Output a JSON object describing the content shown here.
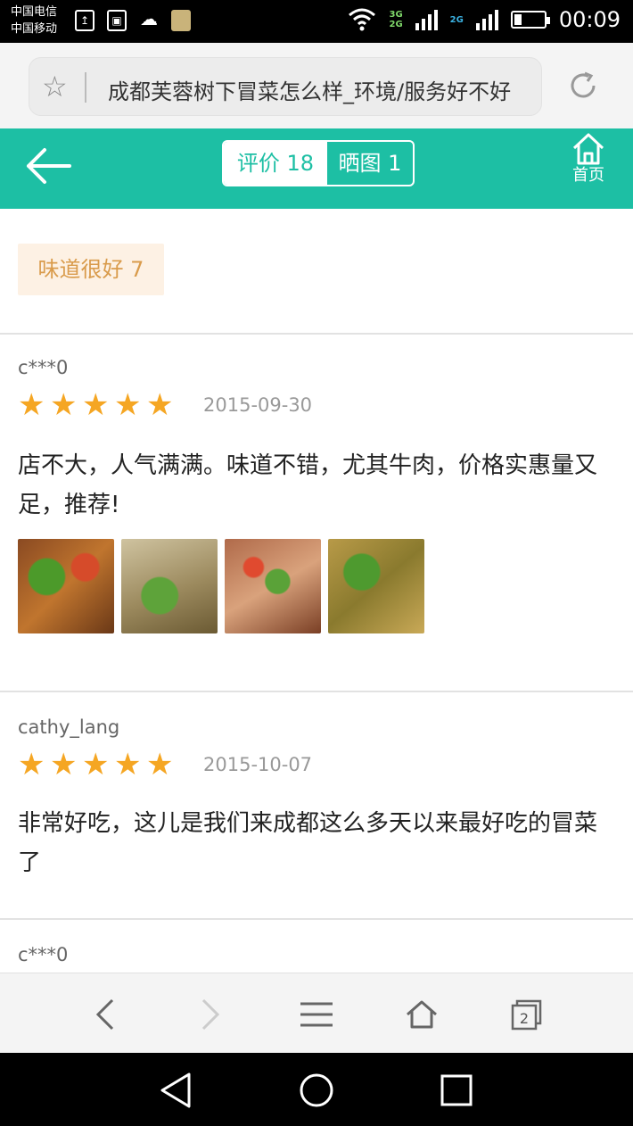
{
  "status_bar": {
    "carrier_1": "中国电信",
    "carrier_2": "中国移动",
    "net_1": "3G",
    "net_2": "2G",
    "net_3": "2G",
    "time": "00:09"
  },
  "browser": {
    "url_title": "成都芙蓉树下冒菜怎么样_环境/服务好不好",
    "tabs_count": "2"
  },
  "header": {
    "tab_reviews": "评价 18",
    "tab_photos": "晒图 1",
    "home_label": "首页"
  },
  "tag": {
    "label": "味道很好 7"
  },
  "reviews": [
    {
      "author": "c***0",
      "rating": 5,
      "date": "2015-09-30",
      "content": "店不大，人气满满。味道不错，尤其牛肉，价格实惠量又足，推荐!",
      "photo_count": 4
    },
    {
      "author": "cathy_lang",
      "rating": 5,
      "date": "2015-10-07",
      "content": "非常好吃，这儿是我们来成都这么多天以来最好吃的冒菜了"
    },
    {
      "author": "c***0"
    }
  ],
  "colors": {
    "accent": "#1dbfa4",
    "star": "#f5a623",
    "tag_bg": "#fdf1e4",
    "tag_text": "#d99b4b"
  }
}
